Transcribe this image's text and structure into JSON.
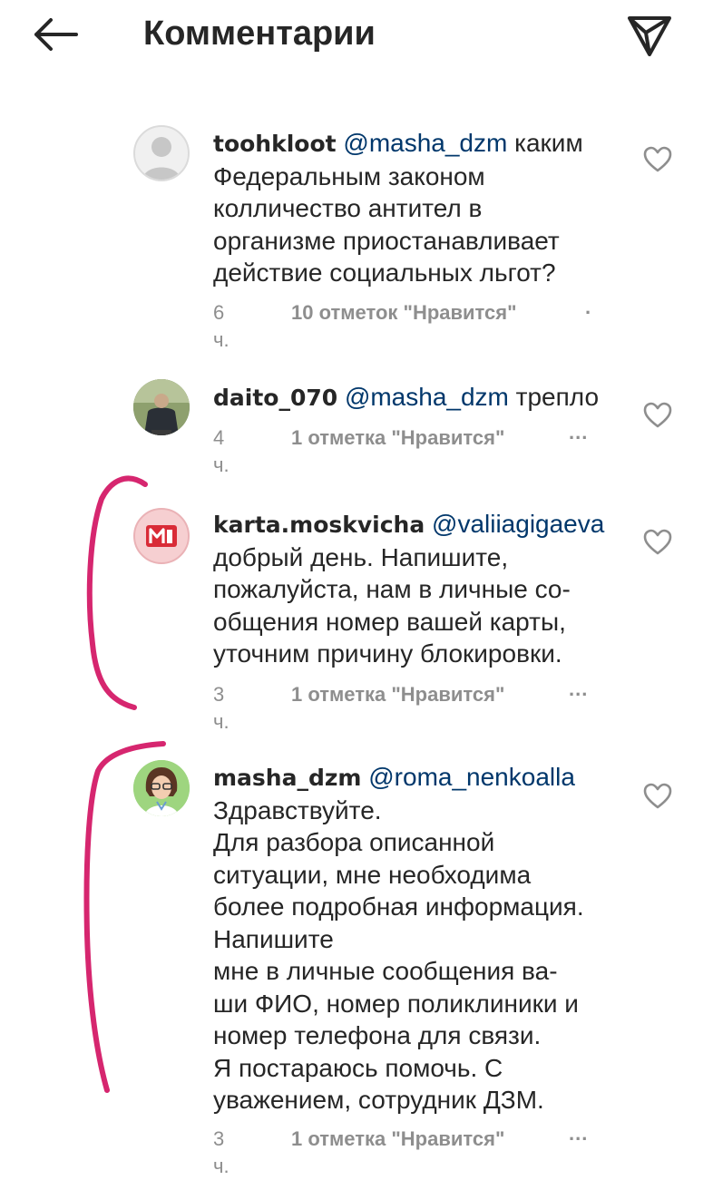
{
  "header": {
    "title": "Комментарии"
  },
  "comments": [
    {
      "username": "toohkloot",
      "mention": "@masha_dzm",
      "text": "каким\nФедеральным законом\nколличество антител в\nорганизме приостанавливает\nдействие  социальных льгот?",
      "time": "6 ч.",
      "likes": "10 отметок \"Нравится\"",
      "more": "."
    },
    {
      "username": "daito_070",
      "mention": "@masha_dzm",
      "text": "трепло",
      "time": "4 ч.",
      "likes": "1 отметка \"Нравится\"",
      "more": "..."
    },
    {
      "username": "karta.moskvicha",
      "mention": "@valiiagigaeva",
      "text": "\nдобрый день. Напишите,\nпожалуйста, нам в личные со-\nобщения номер вашей карты,\nуточним причину блокировки.",
      "time": "3 ч.",
      "likes": "1 отметка \"Нравится\"",
      "more": "..."
    },
    {
      "username": "masha_dzm",
      "mention": "@roma_nenkoalla",
      "text": "\nЗдравствуйте.\nДля разбора описанной\nситуации, мне необходима\nболее подробная информация.\nНапишите\nмне в личные сообщения ва-\nши ФИО, номер поликлиники и\nномер телефона для связи.\nЯ постараюсь помочь. С\nуважением, сотрудник ДЗМ.",
      "time": "3 ч.",
      "likes": "1 отметка \"Нравится\"",
      "more": "..."
    }
  ],
  "icons": {
    "back": "arrow-left-icon",
    "share": "paper-plane-icon",
    "like": "heart-outline-icon"
  },
  "colors": {
    "text": "#262626",
    "meta": "#8e8e8e",
    "mention": "#00376b",
    "annotation": "#d6266f"
  }
}
